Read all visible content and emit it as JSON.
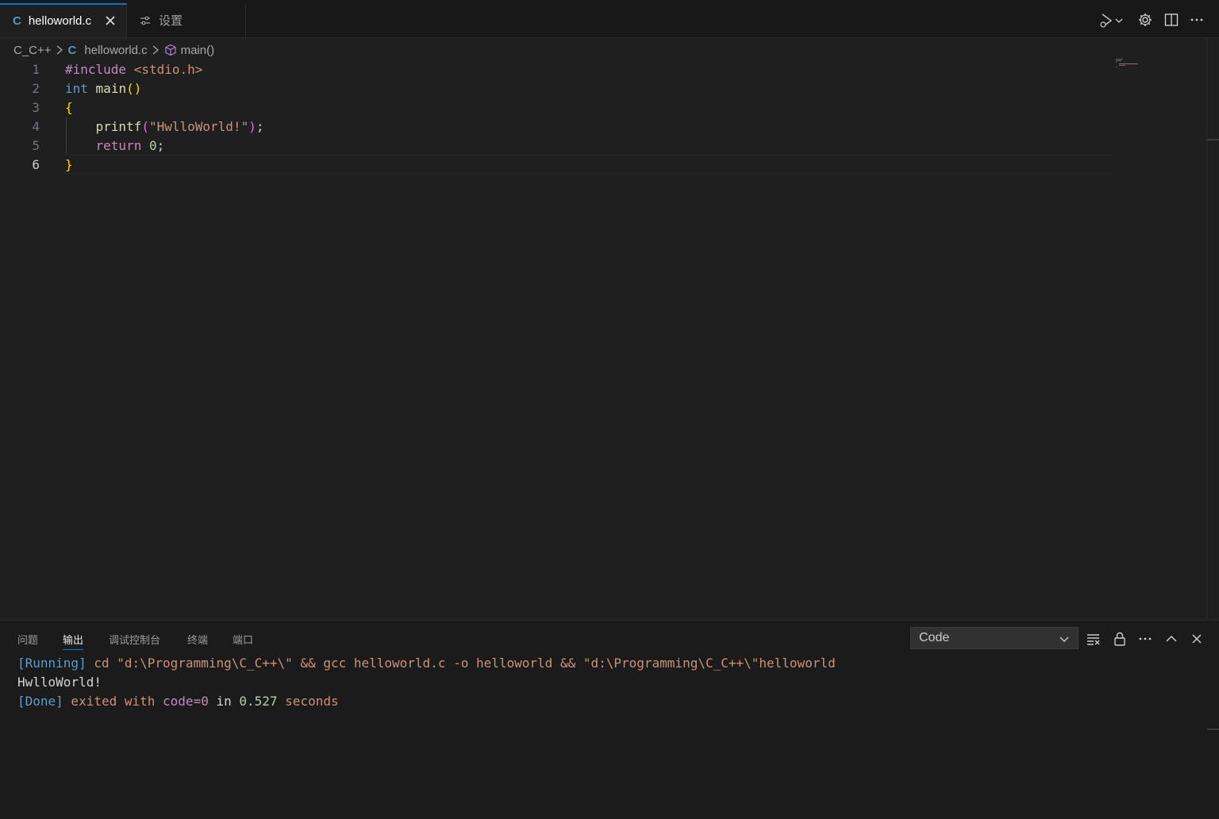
{
  "tabs": {
    "active": {
      "language_badge": "C",
      "label": "helloworld.c"
    },
    "settings": {
      "label": "设置"
    }
  },
  "breadcrumb": {
    "folder": "C_C++",
    "file_badge": "C",
    "file": "helloworld.c",
    "symbol": "main()"
  },
  "editor": {
    "active_line": 6,
    "lines": [
      {
        "n": "1",
        "include": "#include",
        "header": "<stdio.h>"
      },
      {
        "n": "2",
        "type": "int",
        "fn": "main",
        "open": "(",
        "close": ")"
      },
      {
        "n": "3",
        "brace": "{"
      },
      {
        "n": "4",
        "fn": "printf",
        "open": "(",
        "str": "\"HwlloWorld!\"",
        "close": ")",
        "semi": ";"
      },
      {
        "n": "5",
        "kw": "return",
        "num": "0",
        "semi": ";"
      },
      {
        "n": "6",
        "brace": "}"
      }
    ]
  },
  "panel": {
    "tabs": [
      "问题",
      "输出",
      "调试控制台",
      "终端",
      "端口"
    ],
    "active_tab": "输出",
    "output_channel": "Code",
    "output": {
      "line1": {
        "tag": "[Running]",
        "cmd": " cd \"d:\\Programming\\C_C++\\\" && gcc helloworld.c -o helloworld && \"d:\\Programming\\C_C++\\\"helloworld"
      },
      "line2": {
        "text": "HwlloWorld!"
      },
      "line3": {
        "tag": "[Done]",
        "p1": " exited with ",
        "code": "code=0",
        "p2": " in ",
        "secs": "0.527",
        "p3": " seconds"
      }
    }
  },
  "icons": [
    "close-icon",
    "settings-sliders-icon",
    "run-debug-icon",
    "chevron-down-icon",
    "gear-icon",
    "split-editor-icon",
    "more-icon",
    "chevron-right-icon",
    "symbol-method-icon",
    "clear-output-icon",
    "lock-icon",
    "chevron-up-icon"
  ],
  "colors": {
    "accent": "#0078d4",
    "editor_bg": "#1f1f1f",
    "tabbar_bg": "#181818"
  }
}
